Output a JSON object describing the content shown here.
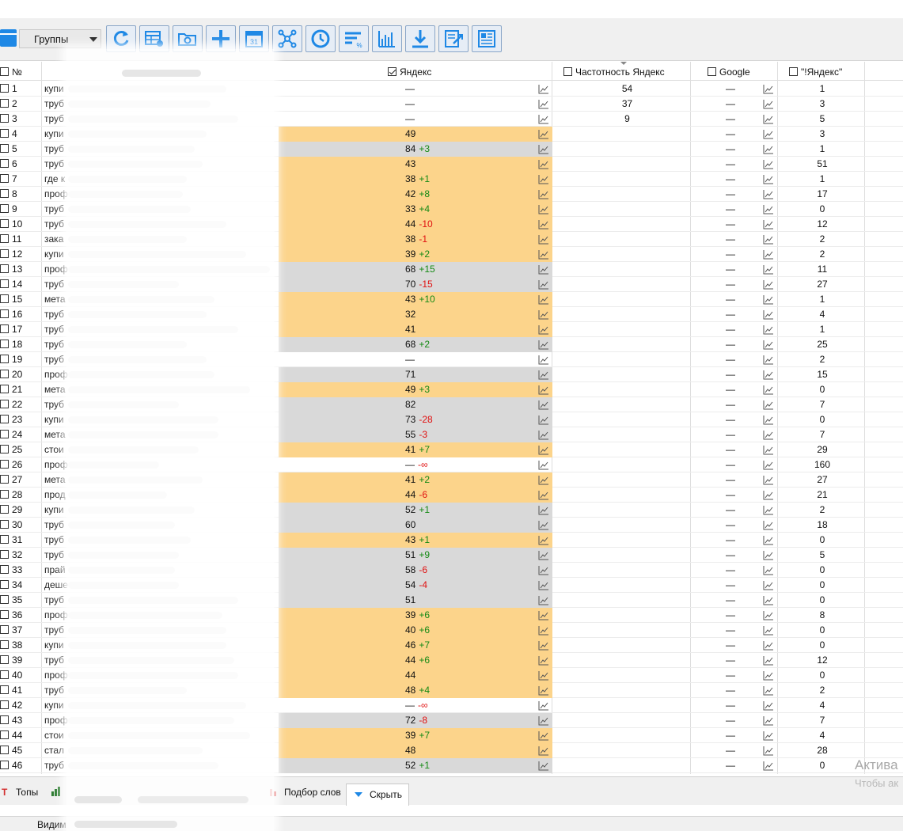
{
  "toolbar": {
    "groups_label": "Группы",
    "buttons": [
      "refresh-icon",
      "table-settings-icon",
      "folder-settings-icon",
      "add-icon",
      "calendar-icon",
      "network-icon",
      "clock-icon",
      "filter-percent-icon",
      "chart-icon",
      "download-icon",
      "export-icon",
      "report-icon"
    ]
  },
  "columns": {
    "no": "№",
    "yandex": "Яндекс",
    "freq": "Частотность Яндекс",
    "google": "Google",
    "exact": "\"!Яндекс\""
  },
  "rows": [
    {
      "no": "1",
      "kw": "купи",
      "ya": "—",
      "d": "",
      "bg": "w",
      "fq": "54",
      "gg": "—",
      "ex": "1"
    },
    {
      "no": "2",
      "kw": "труб",
      "ya": "—",
      "d": "",
      "bg": "w",
      "fq": "37",
      "gg": "—",
      "ex": "3"
    },
    {
      "no": "3",
      "kw": "труб",
      "ya": "—",
      "d": "",
      "bg": "w",
      "fq": "9",
      "gg": "—",
      "ex": "5"
    },
    {
      "no": "4",
      "kw": "купи",
      "ya": "49",
      "d": "",
      "bg": "o",
      "fq": "",
      "gg": "—",
      "ex": "3"
    },
    {
      "no": "5",
      "kw": "труб",
      "ya": "84",
      "d": "+3",
      "bg": "g",
      "fq": "",
      "gg": "—",
      "ex": "1"
    },
    {
      "no": "6",
      "kw": "труб",
      "ya": "43",
      "d": "",
      "bg": "o",
      "fq": "",
      "gg": "—",
      "ex": "51"
    },
    {
      "no": "7",
      "kw": "где к",
      "ya": "38",
      "d": "+1",
      "bg": "o",
      "fq": "",
      "gg": "—",
      "ex": "1"
    },
    {
      "no": "8",
      "kw": "проф",
      "ya": "42",
      "d": "+8",
      "bg": "o",
      "fq": "",
      "gg": "—",
      "ex": "17"
    },
    {
      "no": "9",
      "kw": "труб",
      "ya": "33",
      "d": "+4",
      "bg": "o",
      "fq": "",
      "gg": "—",
      "ex": "0"
    },
    {
      "no": "10",
      "kw": "труб",
      "ya": "44",
      "d": "-10",
      "bg": "o",
      "fq": "",
      "gg": "—",
      "ex": "12"
    },
    {
      "no": "11",
      "kw": "зака",
      "ya": "38",
      "d": "-1",
      "bg": "o",
      "fq": "",
      "gg": "—",
      "ex": "2"
    },
    {
      "no": "12",
      "kw": "купи",
      "ya": "39",
      "d": "+2",
      "bg": "o",
      "fq": "",
      "gg": "—",
      "ex": "2"
    },
    {
      "no": "13",
      "kw": "проф",
      "ya": "68",
      "d": "+15",
      "bg": "g",
      "fq": "",
      "gg": "—",
      "ex": "11"
    },
    {
      "no": "14",
      "kw": "труб",
      "ya": "70",
      "d": "-15",
      "bg": "g",
      "fq": "",
      "gg": "—",
      "ex": "27"
    },
    {
      "no": "15",
      "kw": "мета",
      "ya": "43",
      "d": "+10",
      "bg": "o",
      "fq": "",
      "gg": "—",
      "ex": "1"
    },
    {
      "no": "16",
      "kw": "труб",
      "ya": "32",
      "d": "",
      "bg": "o",
      "fq": "",
      "gg": "—",
      "ex": "4"
    },
    {
      "no": "17",
      "kw": "труб",
      "ya": "41",
      "d": "",
      "bg": "o",
      "fq": "",
      "gg": "—",
      "ex": "1"
    },
    {
      "no": "18",
      "kw": "труб",
      "ya": "68",
      "d": "+2",
      "bg": "g",
      "fq": "",
      "gg": "—",
      "ex": "25"
    },
    {
      "no": "19",
      "kw": "труб",
      "ya": "—",
      "d": "",
      "bg": "w",
      "fq": "",
      "gg": "—",
      "ex": "2"
    },
    {
      "no": "20",
      "kw": "проф",
      "ya": "71",
      "d": "",
      "bg": "g",
      "fq": "",
      "gg": "—",
      "ex": "15"
    },
    {
      "no": "21",
      "kw": "мета",
      "ya": "49",
      "d": "+3",
      "bg": "o",
      "fq": "",
      "gg": "—",
      "ex": "0"
    },
    {
      "no": "22",
      "kw": "труб",
      "ya": "82",
      "d": "",
      "bg": "g",
      "fq": "",
      "gg": "—",
      "ex": "7"
    },
    {
      "no": "23",
      "kw": "купи",
      "ya": "73",
      "d": "-28",
      "bg": "g",
      "fq": "",
      "gg": "—",
      "ex": "0"
    },
    {
      "no": "24",
      "kw": "мета",
      "ya": "55",
      "d": "-3",
      "bg": "g",
      "fq": "",
      "gg": "—",
      "ex": "7"
    },
    {
      "no": "25",
      "kw": "стои",
      "ya": "41",
      "d": "+7",
      "bg": "o",
      "fq": "",
      "gg": "—",
      "ex": "29"
    },
    {
      "no": "26",
      "kw": "проф",
      "ya": "—",
      "d": "-∞",
      "bg": "w",
      "fq": "",
      "gg": "—",
      "ex": "160"
    },
    {
      "no": "27",
      "kw": "мета",
      "ya": "41",
      "d": "+2",
      "bg": "o",
      "fq": "",
      "gg": "—",
      "ex": "27"
    },
    {
      "no": "28",
      "kw": "прод",
      "ya": "44",
      "d": "-6",
      "bg": "o",
      "fq": "",
      "gg": "—",
      "ex": "21"
    },
    {
      "no": "29",
      "kw": "купи",
      "ya": "52",
      "d": "+1",
      "bg": "g",
      "fq": "",
      "gg": "—",
      "ex": "2"
    },
    {
      "no": "30",
      "kw": "труб",
      "ya": "60",
      "d": "",
      "bg": "g",
      "fq": "",
      "gg": "—",
      "ex": "18"
    },
    {
      "no": "31",
      "kw": "труб",
      "ya": "43",
      "d": "+1",
      "bg": "o",
      "fq": "",
      "gg": "—",
      "ex": "0"
    },
    {
      "no": "32",
      "kw": "труб",
      "ya": "51",
      "d": "+9",
      "bg": "g",
      "fq": "",
      "gg": "—",
      "ex": "5"
    },
    {
      "no": "33",
      "kw": "прай",
      "ya": "58",
      "d": "-6",
      "bg": "g",
      "fq": "",
      "gg": "—",
      "ex": "0"
    },
    {
      "no": "34",
      "kw": "деше",
      "ya": "54",
      "d": "-4",
      "bg": "g",
      "fq": "",
      "gg": "—",
      "ex": "0"
    },
    {
      "no": "35",
      "kw": "труб",
      "ya": "51",
      "d": "",
      "bg": "g",
      "fq": "",
      "gg": "—",
      "ex": "0"
    },
    {
      "no": "36",
      "kw": "проф",
      "ya": "39",
      "d": "+6",
      "bg": "o",
      "fq": "",
      "gg": "—",
      "ex": "8"
    },
    {
      "no": "37",
      "kw": "труб",
      "ya": "40",
      "d": "+6",
      "bg": "o",
      "fq": "",
      "gg": "—",
      "ex": "0"
    },
    {
      "no": "38",
      "kw": "купи",
      "ya": "46",
      "d": "+7",
      "bg": "o",
      "fq": "",
      "gg": "—",
      "ex": "0"
    },
    {
      "no": "39",
      "kw": "труб",
      "ya": "44",
      "d": "+6",
      "bg": "o",
      "fq": "",
      "gg": "—",
      "ex": "12"
    },
    {
      "no": "40",
      "kw": "проф",
      "ya": "44",
      "d": "",
      "bg": "o",
      "fq": "",
      "gg": "—",
      "ex": "0"
    },
    {
      "no": "41",
      "kw": "труб",
      "ya": "48",
      "d": "+4",
      "bg": "o",
      "fq": "",
      "gg": "—",
      "ex": "2"
    },
    {
      "no": "42",
      "kw": "купи",
      "ya": "—",
      "d": "-∞",
      "bg": "w",
      "fq": "",
      "gg": "—",
      "ex": "4"
    },
    {
      "no": "43",
      "kw": "проф",
      "ya": "72",
      "d": "-8",
      "bg": "g",
      "fq": "",
      "gg": "—",
      "ex": "7"
    },
    {
      "no": "44",
      "kw": "стои",
      "ya": "39",
      "d": "+7",
      "bg": "o",
      "fq": "",
      "gg": "—",
      "ex": "4"
    },
    {
      "no": "45",
      "kw": "стал",
      "ya": "48",
      "d": "",
      "bg": "o",
      "fq": "",
      "gg": "—",
      "ex": "28"
    },
    {
      "no": "46",
      "kw": "труб",
      "ya": "52",
      "d": "+1",
      "bg": "g",
      "fq": "",
      "gg": "—",
      "ex": "0"
    }
  ],
  "tabs": {
    "tops": "Топы",
    "selection": "Подбор слов",
    "hide": "Скрыть"
  },
  "status": {
    "label": "Видим"
  },
  "watermark": {
    "line1": "Актива",
    "line2": "Чтобы ак"
  },
  "colors": {
    "accent": "#1e88e5",
    "row_orange": "#fcd48b",
    "row_gray": "#d9d9d9",
    "positive": "#148a14",
    "negative": "#e01010"
  }
}
